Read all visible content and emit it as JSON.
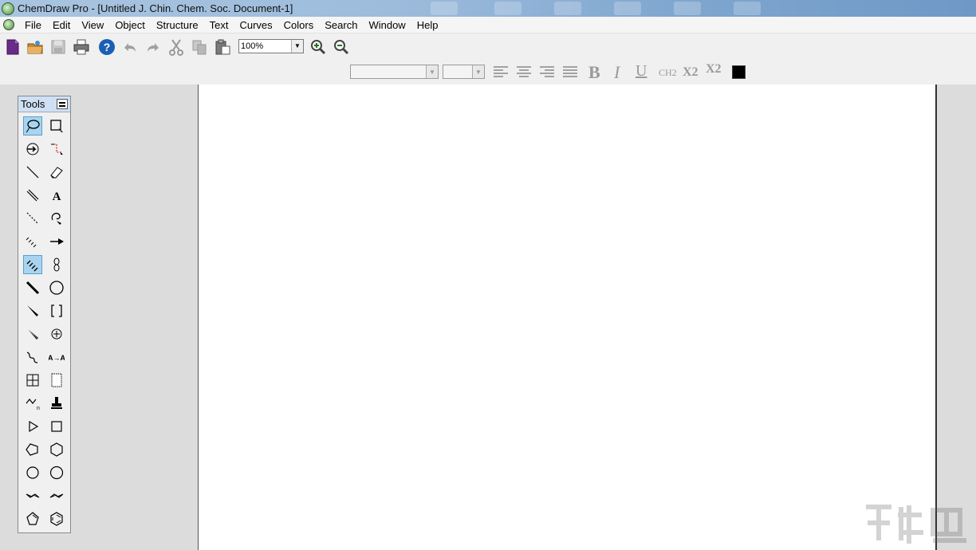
{
  "window": {
    "title": "ChemDraw Pro - [Untitled J. Chin. Chem. Soc. Document-1]"
  },
  "menu": {
    "items": [
      "File",
      "Edit",
      "View",
      "Object",
      "Structure",
      "Text",
      "Curves",
      "Colors",
      "Search",
      "Window",
      "Help"
    ]
  },
  "toolbar": {
    "zoom_value": "100%",
    "font_size_label": "CH2",
    "subscript_label": "X2",
    "superscript_label": "X2",
    "color_swatch": "#000000"
  },
  "tools_palette": {
    "title": "Tools",
    "tools": [
      "lasso-tool",
      "marquee-tool",
      "structure-perspective-tool",
      "mass-fragmentation-tool",
      "solid-bond-tool",
      "eraser-tool",
      "double-bond-tool",
      "text-tool",
      "dashed-bond-tool",
      "pen-tool",
      "hashed-bond-tool",
      "arrow-tool",
      "bold-hashed-bond-tool",
      "orbital-tool",
      "bold-bond-tool",
      "drawing-elements-tool",
      "wedged-bond-tool",
      "brackets-tool",
      "hashed-wedged-bond-tool",
      "chemical-symbols-tool",
      "wavy-bond-tool",
      "query-tool",
      "table-tool",
      "template-tool",
      "acyclic-chain-tool",
      "stamp-tool",
      "cyclopropane-tool",
      "cyclobutane-tool",
      "cyclopentane-tool",
      "cyclohexane-tool",
      "cycloheptane-tool",
      "cyclooctane-tool",
      "cyclohexane-chair-1-tool",
      "cyclohexane-chair-2-tool",
      "cyclopentadiene-tool",
      "benzene-tool"
    ]
  },
  "colors": {
    "selected_tool_bg": "#a8d4f0",
    "titlebar": "#9dbcdc"
  }
}
